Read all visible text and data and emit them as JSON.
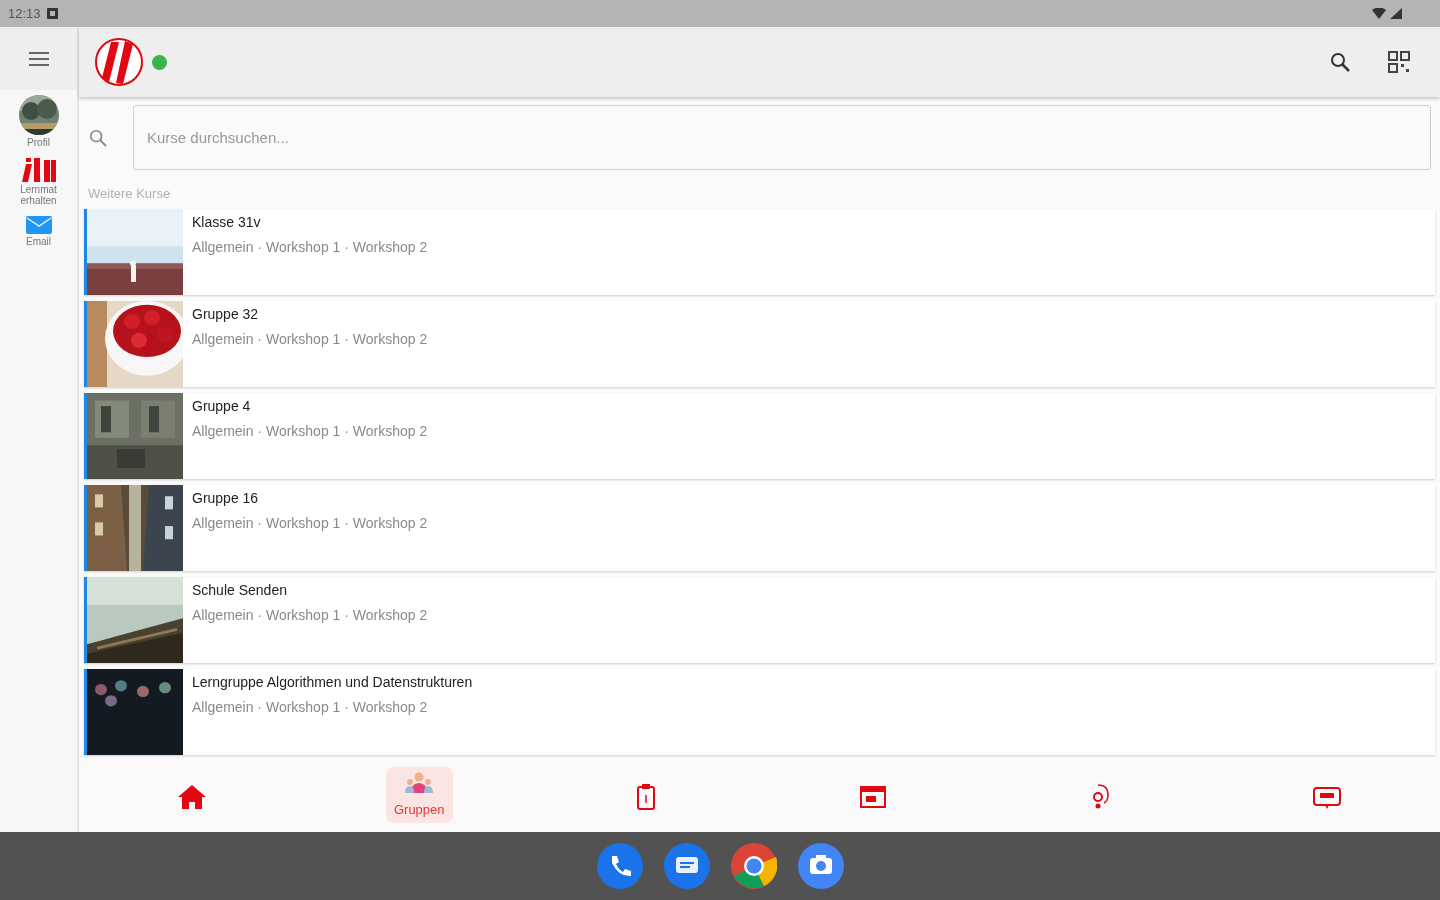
{
  "status_bar": {
    "time": "12:13"
  },
  "rail": [
    {
      "label": "Profil"
    },
    {
      "kind": "logo",
      "label": "Lernmat erhalten"
    },
    {
      "kind": "mail",
      "label": "Email"
    }
  ],
  "header": {
    "online": true
  },
  "search": {
    "placeholder": "Kurse durchsuchen..."
  },
  "section_title": "Weitere Kurse",
  "courses": [
    {
      "title": "Klasse 31v",
      "subtitle": "Allgemein · Workshop 1 · Workshop 2"
    },
    {
      "title": "Gruppe 32",
      "subtitle": "Allgemein · Workshop 1 · Workshop 2"
    },
    {
      "title": "Gruppe 4",
      "subtitle": "Allgemein · Workshop 1 · Workshop 2"
    },
    {
      "title": "Gruppe 16",
      "subtitle": "Allgemein · Workshop 1 · Workshop 2"
    },
    {
      "title": "Schule Senden",
      "subtitle": "Allgemein · Workshop 1 · Workshop 2"
    },
    {
      "title": "Lerngruppe Algorithmen und Datenstrukturen",
      "subtitle": "Allgemein · Workshop 1 · Workshop 2"
    }
  ],
  "bottom_nav": [
    {
      "selected": false
    },
    {
      "label": "Gruppen",
      "selected": true
    },
    {
      "selected": false
    },
    {
      "selected": false
    },
    {
      "selected": false
    },
    {
      "selected": false
    }
  ]
}
